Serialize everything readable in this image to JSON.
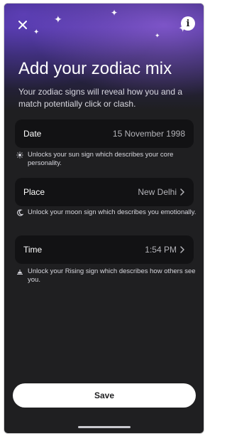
{
  "header": {
    "close_icon": "close-icon",
    "info_icon": "info-icon",
    "info_glyph": "i"
  },
  "main": {
    "title": "Add your zodiac mix",
    "subtitle": "Your zodiac signs will reveal how you and a match potentially click or clash.",
    "rows": [
      {
        "label": "Date",
        "value": "15 November 1998"
      },
      {
        "label": "Place",
        "value": "New Delhi"
      },
      {
        "label": "Time",
        "value": "1:54 PM"
      }
    ],
    "notes": [
      {
        "icon": "sun-icon",
        "text": "Unlocks your sun sign which describes your core personality."
      },
      {
        "icon": "moon-icon",
        "text": "Unlock your moon sign which describes you emotionally."
      },
      {
        "icon": "sunrise-icon",
        "text": "Unlock your Rising sign which describes how others see you."
      }
    ]
  },
  "footer": {
    "save_label": "Save"
  }
}
